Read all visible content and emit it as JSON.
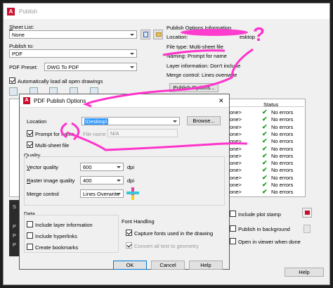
{
  "publish": {
    "title": "Publish",
    "sheet_list_label": "Sheet List:",
    "sheet_list_value": "None",
    "publish_to_label": "Publish to:",
    "publish_to_value": "PDF",
    "pdf_preset_label": "PDF Preset:",
    "pdf_preset_value": "DWG To PDF",
    "auto_load_label": "Automatically load all open drawings",
    "info": {
      "heading": "Publish Options Information",
      "location": "Location: ",
      "location_tail": "esktop",
      "file_type": "File type: Multi-sheet file",
      "naming": "Naming: Prompt for name",
      "layer_info": "Layer information: Don't include",
      "merge_control": "Merge control: Lines overwrite",
      "publish_options_button": "Publish Options..."
    },
    "status_header": "Status",
    "rows": [
      {
        "name": "one>",
        "status": "No errors"
      },
      {
        "name": "one>",
        "status": "No errors"
      },
      {
        "name": "one>",
        "status": "No errors"
      },
      {
        "name": "one>",
        "status": "No errors"
      },
      {
        "name": "one>",
        "status": "No errors"
      },
      {
        "name": "one>",
        "status": "No errors"
      },
      {
        "name": "one>",
        "status": "No errors"
      },
      {
        "name": "one>",
        "status": "No errors"
      },
      {
        "name": "one>",
        "status": "No errors"
      },
      {
        "name": "one>",
        "status": "No errors"
      },
      {
        "name": "one>",
        "status": "No errors"
      },
      {
        "name": "one>",
        "status": "No errors"
      }
    ],
    "include_plot_stamp": "Include plot stamp",
    "publish_in_background": "Publish in background",
    "open_in_viewer": "Open in viewer when done",
    "help": "Help",
    "s_letter": "S",
    "p_letters": [
      "P",
      "P",
      "P"
    ]
  },
  "dialog": {
    "title": "PDF Publish Options",
    "close": "✕",
    "location_label": "Location",
    "location_value": "\\Desktop\\",
    "browse": "Browse...",
    "prompt_for_name": "Prompt for name",
    "file_name_label": "File name",
    "file_name_value": "N/A",
    "multi_sheet": "Multi-sheet file",
    "quality_heading": "Quality",
    "vector_quality_label": "Vector quality",
    "vector_quality_value": "600",
    "raster_quality_label": "Raster image quality",
    "raster_quality_value": "400",
    "dpi": "dpi",
    "merge_control_label": "Merge control",
    "merge_control_value": "Lines Overwrite",
    "data_heading": "Data",
    "include_layer_info": "Include layer information",
    "include_hyperlinks": "Include hyperlinks",
    "create_bookmarks": "Create bookmarks",
    "font_handling_heading": "Font Handling",
    "capture_fonts": "Capture fonts used in the drawing",
    "convert_geometry": "Convert all text to geometry",
    "ok": "OK",
    "cancel": "Cancel",
    "help": "Help"
  },
  "annotation": {
    "question_mark": "?"
  },
  "colors": {
    "annotation": "#ff33cc",
    "accent_red": "#c8102e",
    "selection": "#3399ff",
    "check_green": "#1a9a1a"
  }
}
